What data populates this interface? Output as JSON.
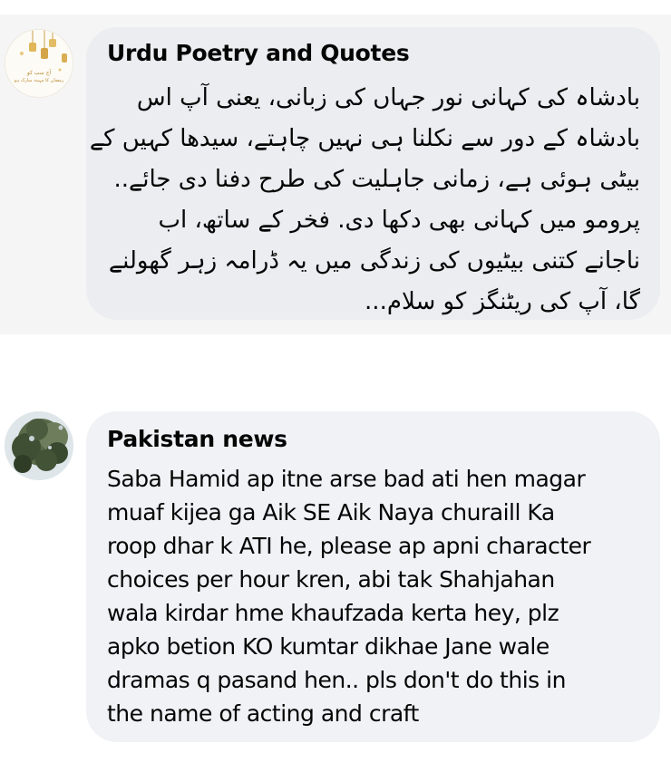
{
  "comments": [
    {
      "author": "Urdu Poetry and Quotes",
      "avatar_icon": "lanterns-logo-icon",
      "avatar_text": [
        "آج سب کو",
        "رمضان کا مہینہ مبارک ہو"
      ],
      "lines": [
        "بادشاہ کی کہانی نور جہاں کی زبانی، یعنی آپ اس",
        "بادشاہ کے دور سے نکلنا ہی نہیں چاہتے، سیدھا کہیں کے",
        "بیٹی ہوئی ہے، زمانی جاہلیت کی طرح دفنا دی جائے..",
        "پرومو میں کہانی بھی دکھا دی. فخر کے ساتھ، اب",
        "ناجانے کتنی بیٹیوں کی زندگی میں یہ ڈرامہ زہر گھولنے",
        "گا، آپ کی ریٹنگز کو سلام..."
      ]
    },
    {
      "author": "Pakistan news",
      "avatar_icon": "tree-photo-icon",
      "lines": [
        "Saba Hamid ap itne arse bad ati hen magar",
        "muaf kijea ga Aik SE Aik Naya churaill Ka",
        "roop dhar k ATI he, please ap apni character",
        "choices per hour kren, abi tak Shahjahan",
        "wala kirdar hme khaufzada kerta hey, plz",
        "apko betion KO kumtar dikhae Jane wale",
        "dramas q pasand hen.. pls don't do this in",
        "the name of acting and craft"
      ]
    }
  ]
}
